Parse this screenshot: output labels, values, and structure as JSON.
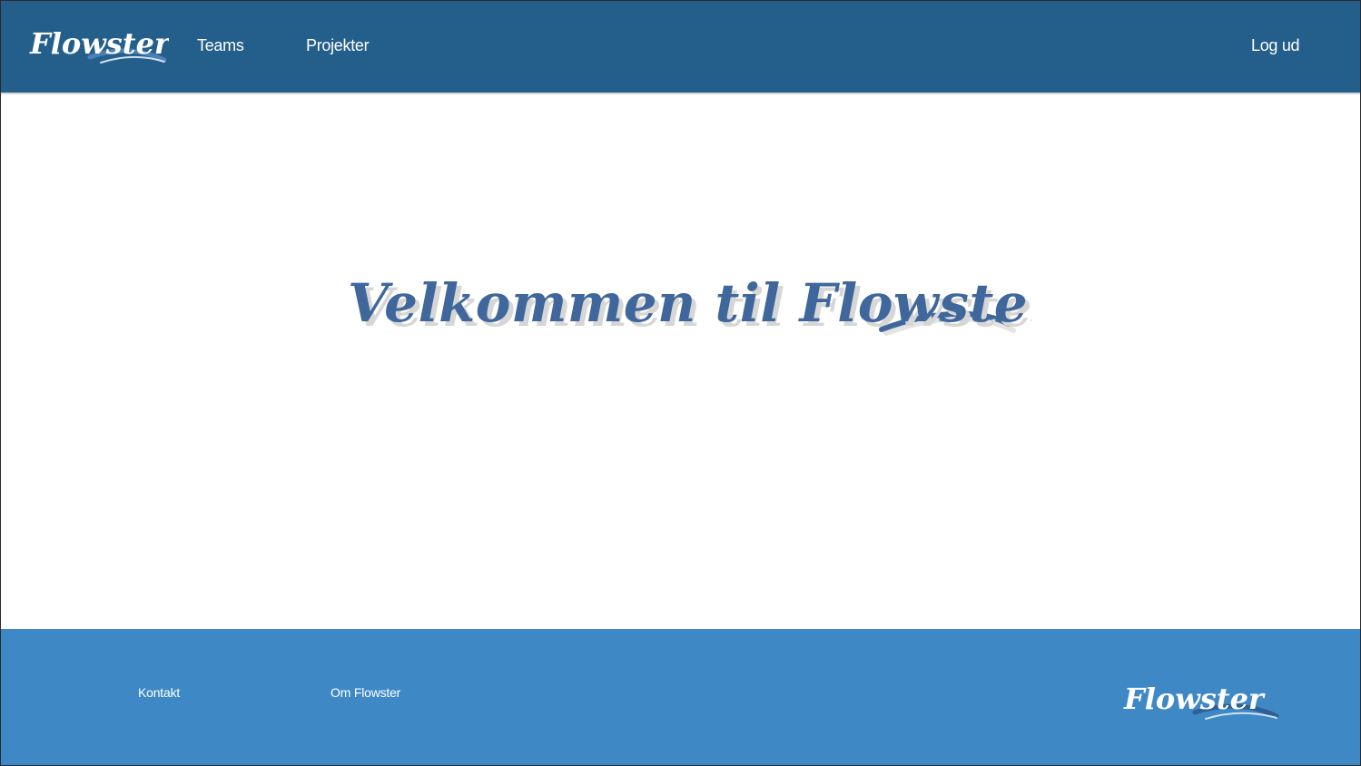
{
  "header": {
    "logo_text": "Flowster",
    "nav": {
      "teams": "Teams",
      "projects": "Projekter",
      "logout": "Log ud"
    }
  },
  "main": {
    "welcome_text": "Velkommen til Flowster"
  },
  "footer": {
    "contact": "Kontakt",
    "about": "Om Flowster",
    "logo_text": "Flowster"
  },
  "colors": {
    "header_bg": "#245f8c",
    "footer_bg": "#3e89c5",
    "welcome_text": "#3f679c"
  }
}
